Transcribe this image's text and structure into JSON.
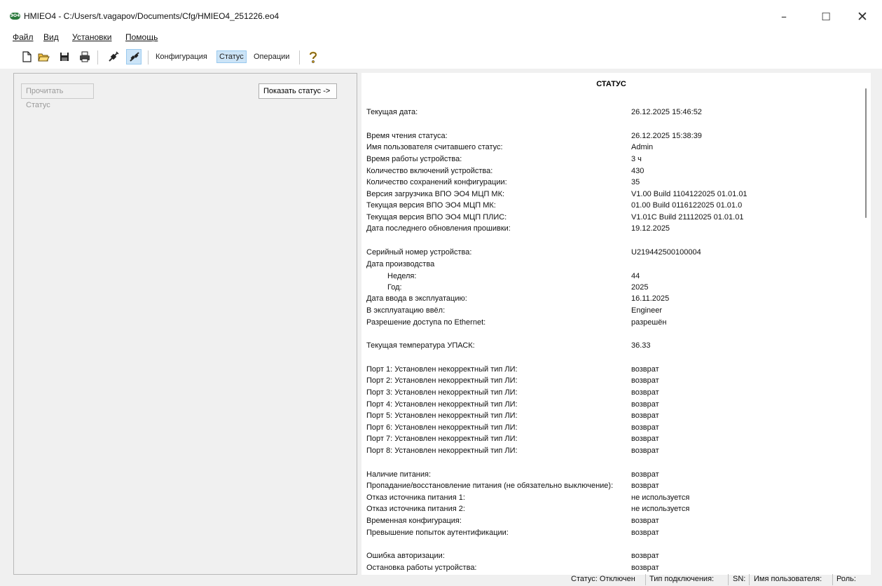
{
  "window": {
    "app_icon_text": "ЭО4",
    "title": "HMIEO4 - C:/Users/t.vagapov/Documents/Cfg/HMIEO4_251226.eo4",
    "min_glyph": "–",
    "max_glyph": "☐",
    "close_glyph": "✕"
  },
  "menu": {
    "file": "Файл",
    "view": "Вид",
    "settings": "Установки",
    "help": "Помощь"
  },
  "toolbar": {
    "config_tab": "Конфигурация",
    "status_tab": "Статус",
    "operations_tab": "Операции"
  },
  "left": {
    "read_status_button": "Прочитать Статус",
    "show_status_button": "Показать статус ->"
  },
  "status": {
    "title": "СТАТУС",
    "rows": [
      {
        "key": "Текущая дата:",
        "value": "26.12.2025 15:46:52"
      },
      {
        "key": "Время чтения статуса:",
        "value": "26.12.2025 15:38:39"
      },
      {
        "key": "Имя пользователя считавшего статус:",
        "value": "Admin"
      },
      {
        "key": "Время работы устройства:",
        "value": "3 ч"
      },
      {
        "key": "Количество включений устройства:",
        "value": "430"
      },
      {
        "key": "Количество сохранений конфигурации:",
        "value": "35"
      },
      {
        "key": "Версия загрузчика ВПО ЭО4 МЦП МК:",
        "value": "V1.00 Build 1104122025 01.01.01"
      },
      {
        "key": "Текущая версия ВПО ЭО4 МЦП МК:",
        "value": "01.00 Build 0116122025 01.01.0"
      },
      {
        "key": "Текущая версия ВПО ЭО4 МЦП ПЛИС:",
        "value": "V1.01C Build 21112025 01.01.01"
      },
      {
        "key": "Дата последнего обновления прошивки:",
        "value": "19.12.2025"
      },
      {
        "key": "Серийный номер устройства:",
        "value": "U219442500100004"
      },
      {
        "key": "Дата производства",
        "value": ""
      },
      {
        "key": "Неделя:",
        "value": "44"
      },
      {
        "key": "Год:",
        "value": "2025"
      },
      {
        "key": "Дата ввода в эксплуатацию:",
        "value": "16.11.2025"
      },
      {
        "key": "В эксплуатацию ввёл:",
        "value": "Engineer"
      },
      {
        "key": "Разрешение доступа по Ethernet:",
        "value": "разрешён"
      },
      {
        "key": "Текущая температура УПАСК:",
        "value": "36.33"
      },
      {
        "key": "Порт 1: Установлен некорректный тип ЛИ:",
        "value": "возврат"
      },
      {
        "key": "Порт 2: Установлен некорректный тип ЛИ:",
        "value": "возврат"
      },
      {
        "key": "Порт 3: Установлен некорректный тип ЛИ:",
        "value": "возврат"
      },
      {
        "key": "Порт 4: Установлен некорректный тип ЛИ:",
        "value": "возврат"
      },
      {
        "key": "Порт 5: Установлен некорректный тип ЛИ:",
        "value": "возврат"
      },
      {
        "key": "Порт 6: Установлен некорректный тип ЛИ:",
        "value": "возврат"
      },
      {
        "key": "Порт 7: Установлен некорректный тип ЛИ:",
        "value": "возврат"
      },
      {
        "key": "Порт 8: Установлен некорректный тип ЛИ:",
        "value": "возврат"
      },
      {
        "key": "Наличие питания:",
        "value": "возврат"
      },
      {
        "key": "Пропадание/восстановление питания (не обязательно выключение):",
        "value": "возврат"
      },
      {
        "key": "Отказ источника питания 1:",
        "value": "не используется"
      },
      {
        "key": "Отказ источника питания 2:",
        "value": "не используется"
      },
      {
        "key": "Временная конфигурация:",
        "value": "возврат"
      },
      {
        "key": "Превышение попыток аутентификации:",
        "value": "возврат"
      },
      {
        "key": "Ошибка авторизации:",
        "value": "возврат"
      },
      {
        "key": "Остановка работы устройства:",
        "value": "возврат"
      }
    ]
  },
  "statusbar": {
    "connection": "Статус: Отключен",
    "conn_type": "Тип подключения:",
    "sn": "SN:",
    "user": "Имя пользователя:",
    "role": "Роль:"
  },
  "colors": {
    "accent_bg": "#cce4f7",
    "accent_border": "#99c9ef",
    "app_icon": "#2b7a3d",
    "help_icon": "#d4a017"
  }
}
